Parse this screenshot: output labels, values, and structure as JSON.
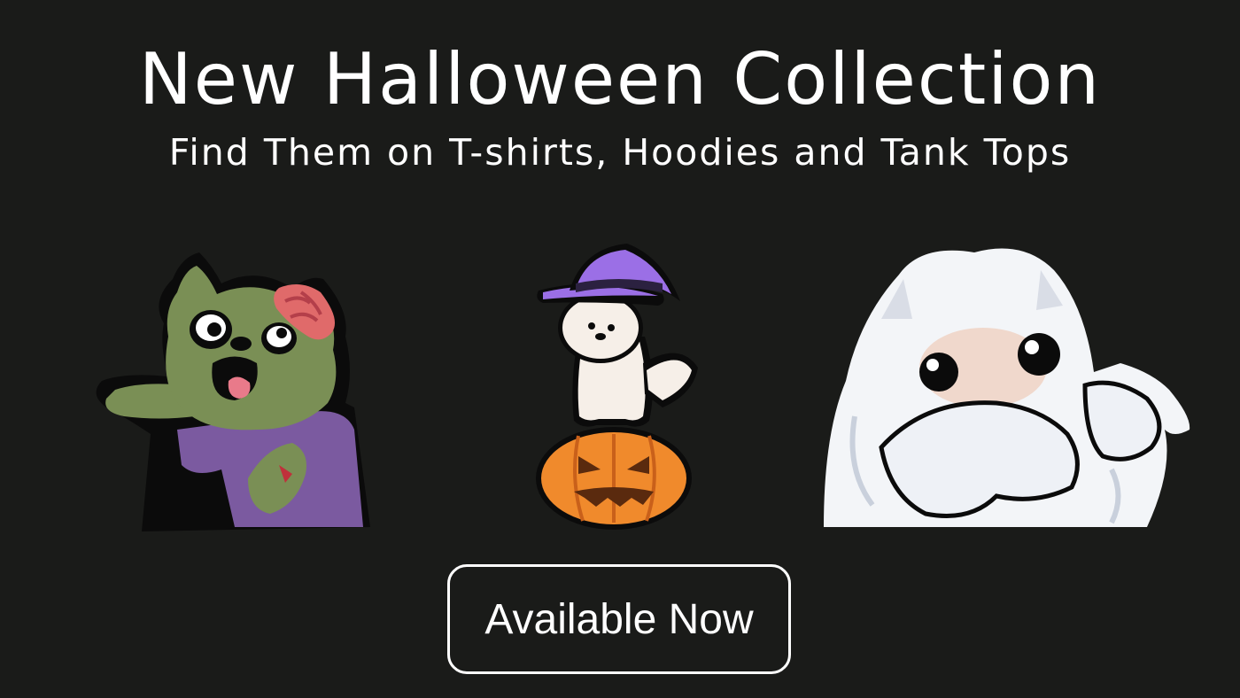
{
  "banner": {
    "title": "New Halloween Collection",
    "subtitle": "Find Them on T-shirts, Hoodies and Tank Tops",
    "cta_label": "Available Now",
    "illustrations": [
      {
        "icon": "zombie-dog-icon"
      },
      {
        "icon": "witch-puppy-on-pumpkin-icon"
      },
      {
        "icon": "ghost-dog-icon"
      }
    ]
  },
  "colors": {
    "background": "#1a1b19",
    "text": "#ffffff",
    "zombie_green": "#7a8f55",
    "zombie_shirt": "#7b5aa0",
    "witch_hat": "#9b6fe6",
    "pumpkin": "#f08a2c",
    "ghost": "#f3f5f8"
  }
}
